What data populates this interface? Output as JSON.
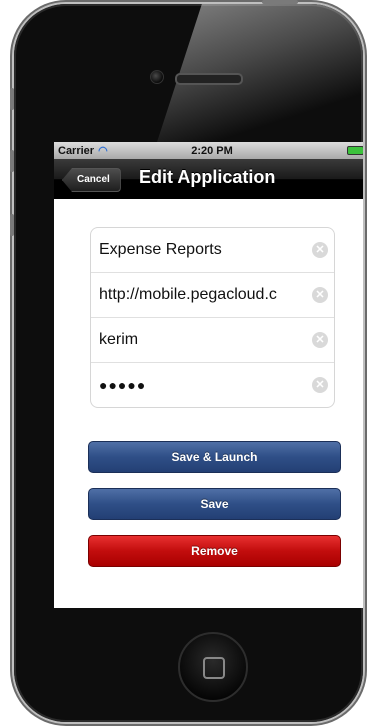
{
  "status_bar": {
    "carrier": "Carrier",
    "time": "2:20 PM"
  },
  "nav": {
    "cancel_label": "Cancel",
    "title": "Edit Application"
  },
  "form": {
    "fields": [
      {
        "value": "Expense Reports"
      },
      {
        "value": "http://mobile.pegacloud.c"
      },
      {
        "value": "kerim"
      },
      {
        "value": "●●●●●"
      }
    ]
  },
  "buttons": {
    "save_launch": "Save & Launch",
    "save": "Save",
    "remove": "Remove"
  },
  "colors": {
    "primary_button": "#2f4f87",
    "remove_button": "#c20d0d"
  }
}
